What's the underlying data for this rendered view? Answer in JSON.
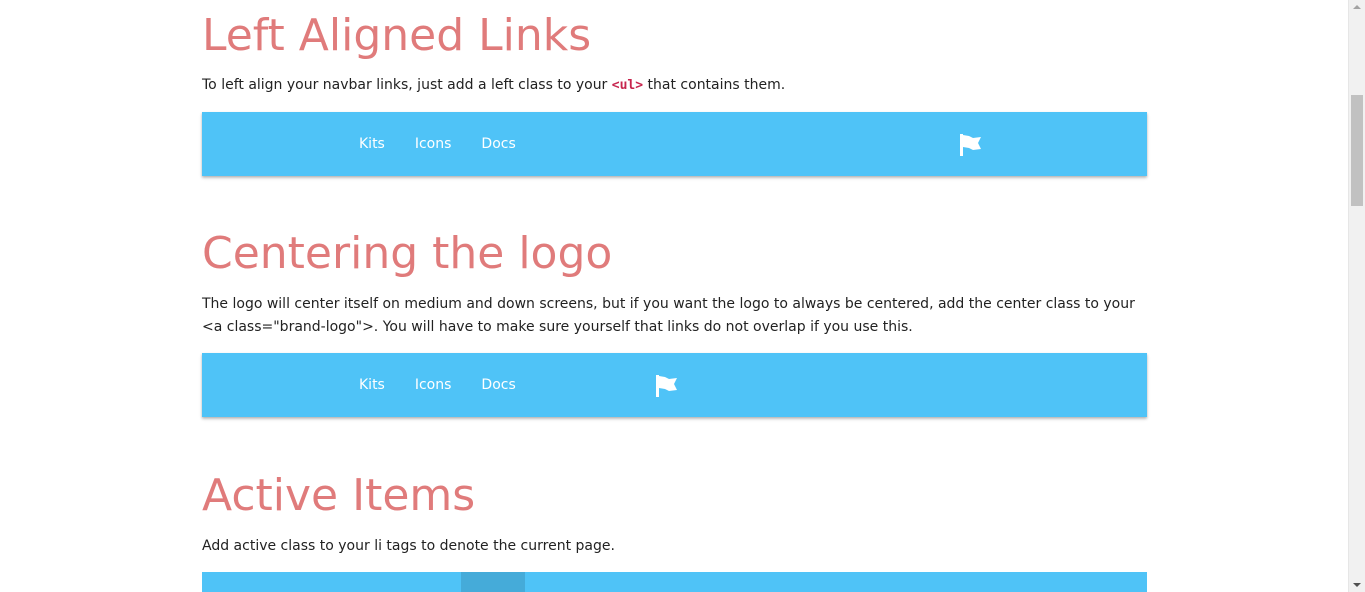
{
  "sections": {
    "left": {
      "title": "Left Aligned Links",
      "desc_before": "To left align your navbar links, just add a left class to your ",
      "desc_code": "<ul>",
      "desc_after": " that contains them.",
      "links": [
        "Kits",
        "Icons",
        "Docs"
      ],
      "logo_icon": "flag-icon"
    },
    "center": {
      "title": "Centering the logo",
      "desc": "The logo will center itself on medium and down screens, but if you want the logo to always be centered, add the center class to your <a class=\"brand-logo\">. You will have to make sure yourself that links do not overlap if you use this.",
      "links": [
        "Kits",
        "Icons",
        "Docs"
      ],
      "logo_icon": "flag-icon"
    },
    "active": {
      "title": "Active Items",
      "desc": "Add active class to your li tags to denote the current page."
    }
  },
  "colors": {
    "heading": "#e07b7b",
    "navbar": "#4fc3f7",
    "code": "#c7254e"
  }
}
